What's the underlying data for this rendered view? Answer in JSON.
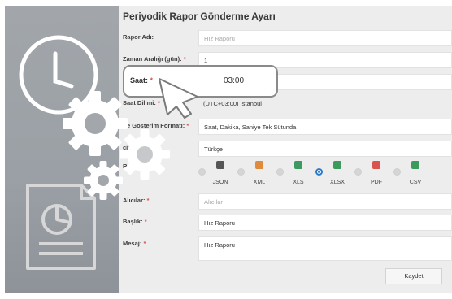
{
  "form": {
    "title": "Periyodik Rapor Gönderme Ayarı",
    "required_mark": "*",
    "fields": {
      "report_name": {
        "label": "Rapor Adı:",
        "placeholder": "Hız Raporu"
      },
      "interval": {
        "label": "Zaman Aralığı (gün):",
        "value": "1"
      },
      "time": {
        "label": "Saat:",
        "value": "03:00"
      },
      "timezone": {
        "label": "Saat Dilimi:",
        "value": "(UTC+03:00) İstanbul"
      },
      "time_format": {
        "label": "ire Gösterim Formatı:",
        "value": "Saat, Dakika, Saniye Tek Sütunda"
      },
      "language": {
        "label": "çimi:",
        "value": "Türkçe"
      },
      "format": {
        "label": "R"
      },
      "recipients": {
        "label": "Alıcılar:",
        "placeholder": "Alıcılar"
      },
      "subject": {
        "label": "Başlık:",
        "value": "Hız Raporu"
      },
      "message": {
        "label": "Mesaj:",
        "value": "Hız Raporu"
      }
    },
    "formats": [
      {
        "label": "JSON",
        "icon": "json-file-icon",
        "color": "#555555",
        "selected": false
      },
      {
        "label": "XML",
        "icon": "xml-file-icon",
        "color": "#e08a3c",
        "selected": false
      },
      {
        "label": "XLS",
        "icon": "xls-file-icon",
        "color": "#3c9a5f",
        "selected": false
      },
      {
        "label": "XLSX",
        "icon": "xlsx-file-icon",
        "color": "#3c9a5f",
        "selected": true
      },
      {
        "label": "PDF",
        "icon": "pdf-file-icon",
        "color": "#d9534f",
        "selected": false
      },
      {
        "label": "CSV",
        "icon": "csv-file-icon",
        "color": "#3c9a5f",
        "selected": false
      }
    ],
    "save_label": "Kaydet"
  },
  "colors": {
    "accent": "#2a7ac8",
    "required": "#d9534f",
    "panel": "#9aa0a5"
  },
  "decor_icons": [
    "clock-icon",
    "gear-icon",
    "report-document-icon",
    "mouse-cursor-icon"
  ]
}
